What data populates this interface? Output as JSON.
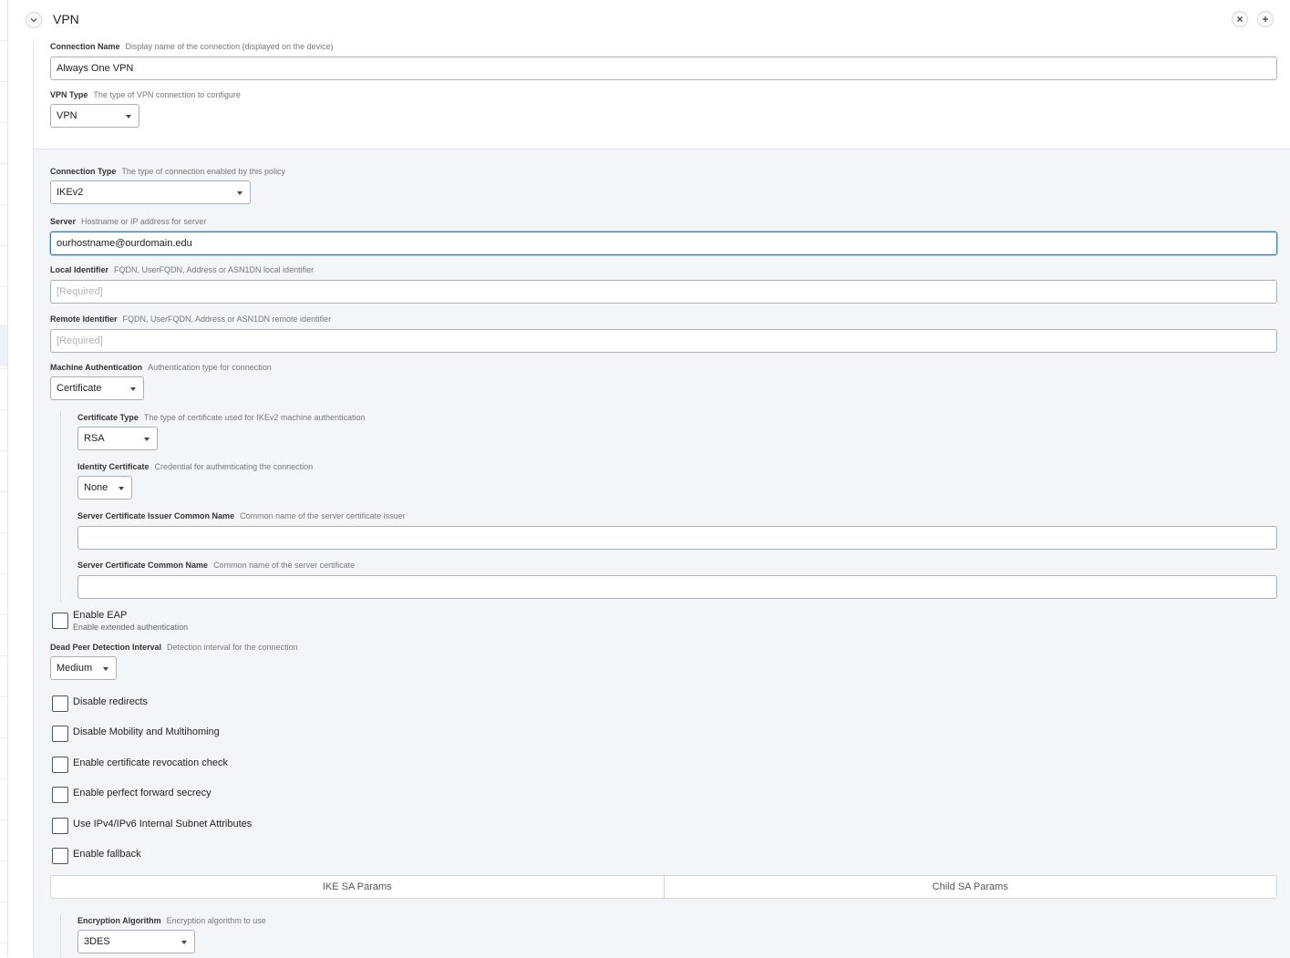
{
  "header": {
    "title": "VPN",
    "collapse_icon": "chevron-down-icon",
    "close_icon": "close-icon",
    "add_icon": "plus-icon"
  },
  "connection_name": {
    "label": "Connection Name",
    "hint": "Display name of the connection (displayed on the device)",
    "value": "Always One VPN"
  },
  "vpn_type": {
    "label": "VPN Type",
    "hint": "The type of VPN connection to configure",
    "value": "VPN"
  },
  "connection_type": {
    "label": "Connection Type",
    "hint": "The type of connection enabled by this policy",
    "value": "IKEv2"
  },
  "server": {
    "label": "Server",
    "hint": "Hostname or IP address for server",
    "value": "ourhostname@ourdomain.edu"
  },
  "local_identifier": {
    "label": "Local Identifier",
    "hint": "FQDN, UserFQDN, Address or ASN1DN local identifier",
    "placeholder": "[Required]"
  },
  "remote_identifier": {
    "label": "Remote Identifier",
    "hint": "FQDN, UserFQDN, Address or ASN1DN remote identifier",
    "placeholder": "[Required]"
  },
  "machine_auth": {
    "label": "Machine Authentication",
    "hint": "Authentication type for connection",
    "value": "Certificate"
  },
  "certificate_type": {
    "label": "Certificate Type",
    "hint": "The type of certificate used for IKEv2 machine authentication",
    "value": "RSA"
  },
  "identity_certificate": {
    "label": "Identity Certificate",
    "hint": "Credential for authenticating the connection",
    "value": "None"
  },
  "issuer_cn": {
    "label": "Server Certificate Issuer Common Name",
    "hint": "Common name of the server certificate issuer",
    "value": ""
  },
  "server_cn": {
    "label": "Server Certificate Common Name",
    "hint": "Common name of the server certificate",
    "value": ""
  },
  "enable_eap": {
    "label": "Enable EAP",
    "sub": "Enable extended authentication",
    "checked": false
  },
  "dpd": {
    "label": "Dead Peer Detection Interval",
    "hint": "Detection interval for the connection",
    "value": "Medium"
  },
  "checkboxes": [
    {
      "label": "Disable redirects",
      "checked": false
    },
    {
      "label": "Disable Mobility and Multihoming",
      "checked": false
    },
    {
      "label": "Enable certificate revocation check",
      "checked": false
    },
    {
      "label": "Enable perfect forward secrecy",
      "checked": false
    },
    {
      "label": "Use IPv4/IPv6 Internal Subnet Attributes",
      "checked": false
    },
    {
      "label": "Enable fallback",
      "checked": false
    }
  ],
  "tabs": [
    {
      "label": "IKE SA Params"
    },
    {
      "label": "Child SA Params"
    }
  ],
  "encryption_algorithm": {
    "label": "Encryption Algorithm",
    "hint": "Encryption algorithm to use",
    "value": "3DES"
  },
  "colors": {
    "focus_border": "#2f80b8",
    "section_background": "#f2f6f9"
  }
}
